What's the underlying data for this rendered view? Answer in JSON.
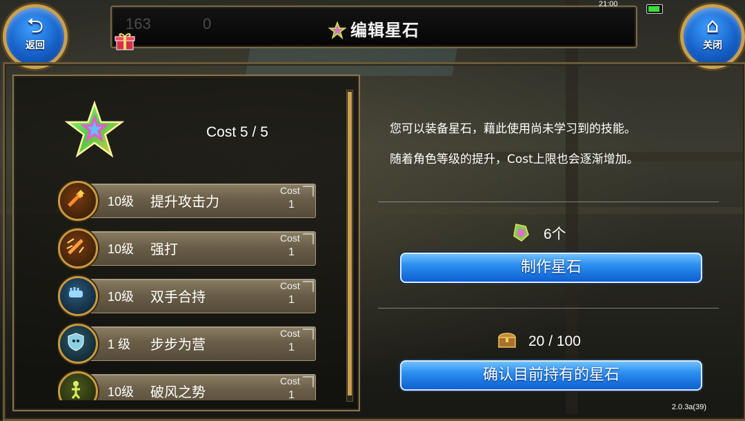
{
  "header": {
    "title": "编辑星石",
    "back_label": "返回",
    "close_label": "关闭",
    "ghost_left_value": "163",
    "ghost_mid_value": "0"
  },
  "status_bar": {
    "time": "21:00"
  },
  "left_panel": {
    "cost_total": "Cost 5 / 5",
    "skills": [
      {
        "level": "10级",
        "name": "提升攻击力",
        "cost_label": "Cost",
        "cost_value": "1",
        "icon": "sword-up-icon"
      },
      {
        "level": "10级",
        "name": "强打",
        "cost_label": "Cost",
        "cost_value": "1",
        "icon": "sword-strike-icon"
      },
      {
        "level": "10级",
        "name": "双手合持",
        "cost_label": "Cost",
        "cost_value": "1",
        "icon": "gauntlet-icon"
      },
      {
        "level": "1 级",
        "name": "步步为营",
        "cost_label": "Cost",
        "cost_value": "1",
        "icon": "shield-skull-icon"
      },
      {
        "level": "10级",
        "name": "破风之势",
        "cost_label": "Cost",
        "cost_value": "1",
        "icon": "wind-figure-icon"
      }
    ]
  },
  "right_panel": {
    "description_line1": "您可以装备星石，藉此使用尚未学习到的技能。",
    "description_line2": "随着角色等级的提升，Cost上限也会逐渐增加。",
    "crystal_count": "6个",
    "craft_button": "制作星石",
    "storage_count": "20 / 100",
    "confirm_button": "确认目前持有的星石"
  },
  "footer": {
    "version": "2.0.3a(39)"
  },
  "colors": {
    "accent_blue": "#2c8ff0",
    "frame_gold": "#c8a050",
    "skill_bar": "#6a5e48"
  }
}
